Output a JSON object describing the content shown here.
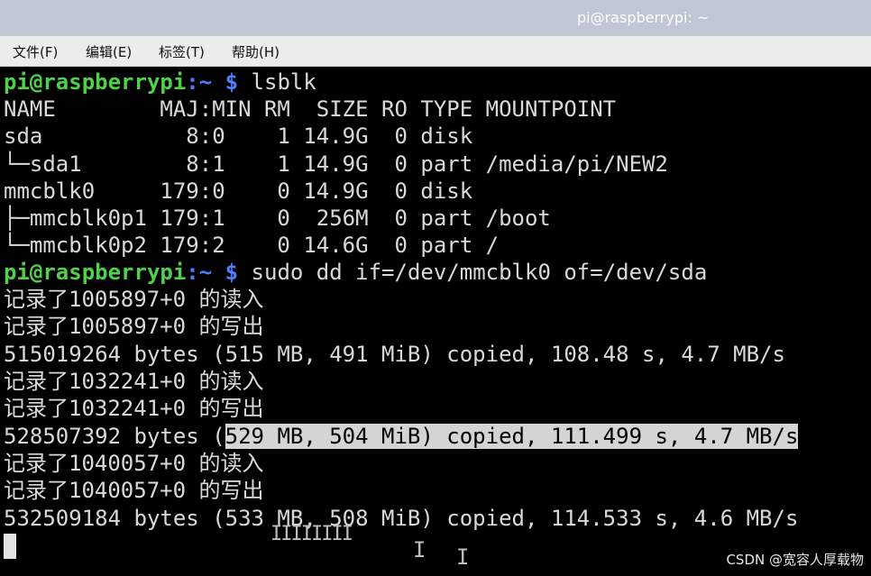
{
  "window": {
    "title": "pi@raspberrypi: ~"
  },
  "menu": [
    {
      "label": "文件(F)"
    },
    {
      "label": "编辑(E)"
    },
    {
      "label": "标签(T)"
    },
    {
      "label": "帮助(H)"
    }
  ],
  "terminal": {
    "prompt1": {
      "user": "pi@raspberrypi",
      "path": ":~",
      "dollar": " $",
      "cmd": " lsblk"
    },
    "lsblk": [
      "NAME        MAJ:MIN RM  SIZE RO TYPE MOUNTPOINT",
      "sda           8:0    1 14.9G  0 disk",
      "└─sda1        8:1    1 14.9G  0 part /media/pi/NEW2",
      "mmcblk0     179:0    0 14.9G  0 disk",
      "├─mmcblk0p1 179:1    0  256M  0 part /boot",
      "└─mmcblk0p2 179:2    0 14.6G  0 part /"
    ],
    "prompt2": {
      "user": "pi@raspberrypi",
      "path": ":~",
      "dollar": " $",
      "cmd": " sudo dd if=/dev/mmcblk0 of=/dev/sda"
    },
    "dd_output": [
      "记录了1005897+0 的读入",
      "记录了1005897+0 的写出",
      "515019264 bytes (515 MB, 491 MiB) copied, 108.48 s, 4.7 MB/s",
      "记录了1032241+0 的读入",
      "记录了1032241+0 的写出"
    ],
    "highlight_line": {
      "prefix": "528507392 bytes (",
      "selected": "529 MB, 504 MiB) copied, 111.499 s, 4.7 MB/s"
    },
    "dd_output2": [
      "记录了1040057+0 的读入",
      "记录了1040057+0 的写出",
      "532509184 bytes (533 MB, 508 MiB) copied, 114.533 s, 4.6 MB/s"
    ]
  },
  "watermark": "CSDN @宽容人厚载物"
}
